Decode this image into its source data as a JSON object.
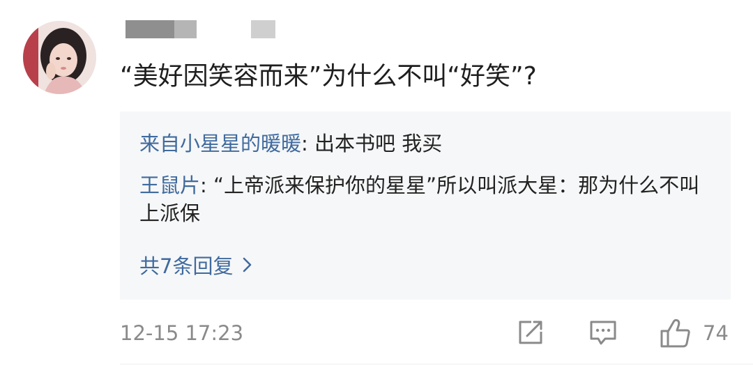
{
  "comment": {
    "text": "“美好因笑容而来”为什么不叫“好笑”?",
    "timestamp": "12-15 17:23",
    "likes": "74"
  },
  "replies": [
    {
      "author": "来自小星星的暖暖",
      "sep": ": ",
      "text": "出本书吧 我买"
    },
    {
      "author": "王鼠片",
      "sep": ": ",
      "text": "“上帝派来保护你的星星”所以叫派大星：那为什么不叫上派保"
    }
  ],
  "more_replies": "共7条回复",
  "icons": {
    "repost": "share-square-icon",
    "comment": "comment-bubble-icon",
    "like": "thumbs-up-icon",
    "chevron": "chevron-right-icon"
  },
  "colors": {
    "link": "#3f6a9e",
    "muted": "#8a8a8a",
    "reply_bg": "#f6f7f8"
  }
}
